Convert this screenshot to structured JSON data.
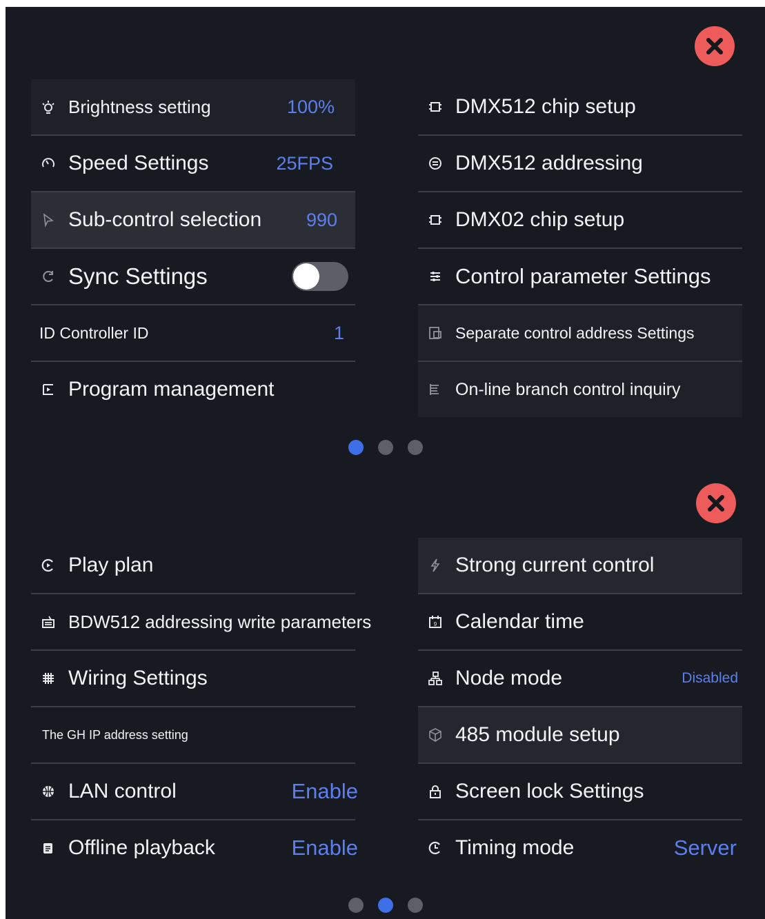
{
  "panel1": {
    "left": [
      {
        "icon": "brightness-icon",
        "label": "Brightness setting",
        "value": "100%"
      },
      {
        "icon": "speedometer-icon",
        "label": "Speed Settings",
        "value": "25FPS"
      },
      {
        "icon": "pointer-icon",
        "label": "Sub-control selection",
        "value": "990"
      },
      {
        "icon": "sync-icon",
        "label": "Sync Settings",
        "toggle_on": false
      },
      {
        "label": "ID Controller ID",
        "value": "1"
      },
      {
        "icon": "program-icon",
        "label": "Program management"
      }
    ],
    "right": [
      {
        "icon": "chip-icon",
        "label": "DMX512 chip setup"
      },
      {
        "icon": "addressing-icon",
        "label": "DMX512 addressing"
      },
      {
        "icon": "chip-icon",
        "label": "DMX02 chip setup"
      },
      {
        "icon": "sliders-icon",
        "label": "Control parameter Settings"
      },
      {
        "icon": "address-card-icon",
        "label": "Separate control address Settings"
      },
      {
        "icon": "list-query-icon",
        "label": "On-line branch control inquiry"
      }
    ],
    "page_dots": {
      "count": 3,
      "active_index": 0
    }
  },
  "panel2": {
    "left": [
      {
        "icon": "play-plan-icon",
        "label": "Play plan"
      },
      {
        "icon": "write-parameters-icon",
        "label": "BDW512 addressing write parameters"
      },
      {
        "icon": "grid-icon",
        "label": "Wiring Settings"
      },
      {
        "label": "The GH IP address setting"
      },
      {
        "icon": "globe-icon",
        "label": "LAN control",
        "value": "Enable"
      },
      {
        "icon": "offline-icon",
        "label": "Offline playback",
        "value": "Enable"
      }
    ],
    "right": [
      {
        "icon": "lightning-icon",
        "label": "Strong current control"
      },
      {
        "icon": "calendar-icon",
        "label": "Calendar time"
      },
      {
        "icon": "node-icon",
        "label": "Node mode",
        "value": "Disabled"
      },
      {
        "icon": "cube-icon",
        "label": "485 module setup"
      },
      {
        "icon": "lock-icon",
        "label": "Screen lock Settings"
      },
      {
        "icon": "clock-icon",
        "label": "Timing mode",
        "value": "Server"
      }
    ],
    "page_dots": {
      "count": 3,
      "active_index": 1
    }
  },
  "colors": {
    "background": "#181a21",
    "accent": "#5b7ff0",
    "close_button": "#ee5b5b",
    "divider": "#3c3f49"
  }
}
